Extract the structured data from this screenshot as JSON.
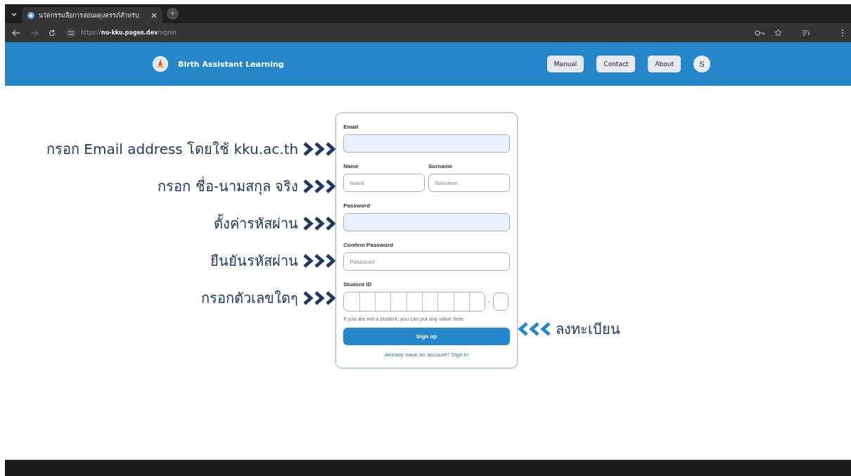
{
  "browser": {
    "tab_title": "นวัตกรรมสื่อการสอนผดุงครรภ์สำหรับ",
    "new_tab": "+",
    "url_scheme": "https://",
    "url_host": "nu-kku.pages.dev",
    "url_path": "/signin"
  },
  "header": {
    "title": "Birth Assistant Learning",
    "nav": [
      "Manual",
      "Contact",
      "About"
    ],
    "avatar": "S"
  },
  "annotations": [
    {
      "text": "กรอก Email address โดยใช้ kku.ac.th"
    },
    {
      "text": "กรอก ชื่อ-นามสกุล จริง"
    },
    {
      "text": "ตั้งค่ารหัสผ่าน"
    },
    {
      "text": "ยืนยันรหัสผ่าน"
    },
    {
      "text": "กรอกตัวเลขใดๆ"
    }
  ],
  "signup_annotation": {
    "text": "ลงทะเบียน"
  },
  "form": {
    "email": {
      "label": "Email",
      "autofilled": true
    },
    "name": {
      "label": "Name",
      "placeholder": "Name",
      "autofilled": false
    },
    "surname": {
      "label": "Surname",
      "placeholder": "Surname",
      "autofilled": false
    },
    "password": {
      "label": "Password",
      "autofilled": true
    },
    "confirm": {
      "label": "Confirm Password",
      "placeholder": "Password",
      "autofilled": false
    },
    "student_id": {
      "label": "Student ID",
      "separator": "·",
      "hint": "If you are not a student, you can put any value here"
    },
    "submit": "Sign up",
    "signin_link": "Already have an account? Sign in"
  }
}
